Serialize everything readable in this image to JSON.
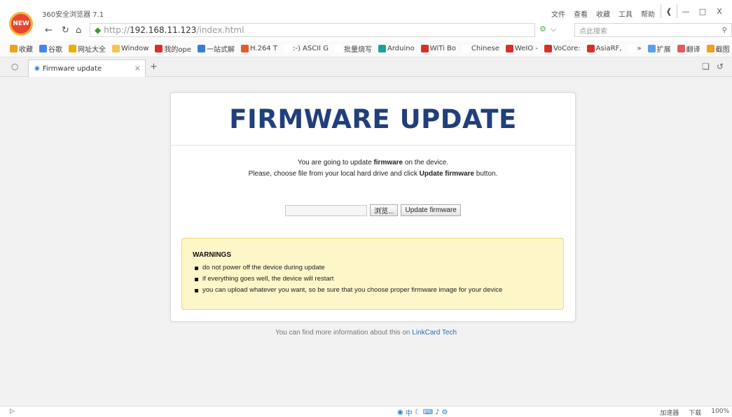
{
  "browser": {
    "logo_badge": "NEW",
    "app_title": "360安全浏览器 7.1",
    "menu": [
      "文件",
      "查看",
      "收藏",
      "工具",
      "帮助"
    ],
    "window_controls": [
      "❰",
      "—",
      "□",
      "X"
    ],
    "address": {
      "scheme": "http://",
      "host": "192.168.11.123",
      "path": "/index.html"
    },
    "search_placeholder": "点此搜索",
    "bookmarks": [
      {
        "label": "收藏",
        "color": "#f0a020"
      },
      {
        "label": "谷歌",
        "color": "#4285f4"
      },
      {
        "label": "网址大全",
        "color": "#e9b000"
      },
      {
        "label": "Window",
        "color": "#f3c74a"
      },
      {
        "label": "我的ope",
        "color": "#d9302a"
      },
      {
        "label": "一站式解",
        "color": "#3a7bd5"
      },
      {
        "label": "H.264 T",
        "color": "#e85a2a"
      },
      {
        "label": ":-) ASCII G",
        "color": "#ffffff"
      },
      {
        "label": "批量烧写",
        "color": "#ffffff"
      },
      {
        "label": "Arduino",
        "color": "#1aa29a"
      },
      {
        "label": "WiTi Bo",
        "color": "#d93025"
      },
      {
        "label": "Chinese",
        "color": "#ffffff"
      },
      {
        "label": "WeIO -",
        "color": "#d93025"
      },
      {
        "label": "VoCore:",
        "color": "#d93025"
      },
      {
        "label": "AsiaRF,",
        "color": "#d93025"
      },
      {
        "label": "»",
        "color": "#ffffff"
      },
      {
        "label": "扩展",
        "color": "#5aa0e6"
      },
      {
        "label": "翻译",
        "color": "#e65a5a"
      },
      {
        "label": "截图",
        "color": "#f0a020"
      }
    ],
    "tab": {
      "title": "Firmware update"
    }
  },
  "page": {
    "title": "FIRMWARE UPDATE",
    "intro_line1_pre": "You are going to update ",
    "intro_line1_bold": "firmware",
    "intro_line1_post": " on the device.",
    "intro_line2_pre": "Please, choose file from your local hard drive and click ",
    "intro_line2_bold": "Update firmware",
    "intro_line2_post": " button.",
    "browse_label": "浏览...",
    "update_label": "Update firmware",
    "warnings_title": "WARNINGS",
    "warnings": [
      "do not power off the device during update",
      "if everything goes well, the device will restart",
      "you can upload whatever you want, so be sure that you choose proper firmware image for your device"
    ],
    "footer_pre": "You can find more information about this on ",
    "footer_link": "LinkCard Tech"
  },
  "statusbar": {
    "left": "▷",
    "right": [
      "加速器",
      "下载",
      "100%"
    ]
  }
}
